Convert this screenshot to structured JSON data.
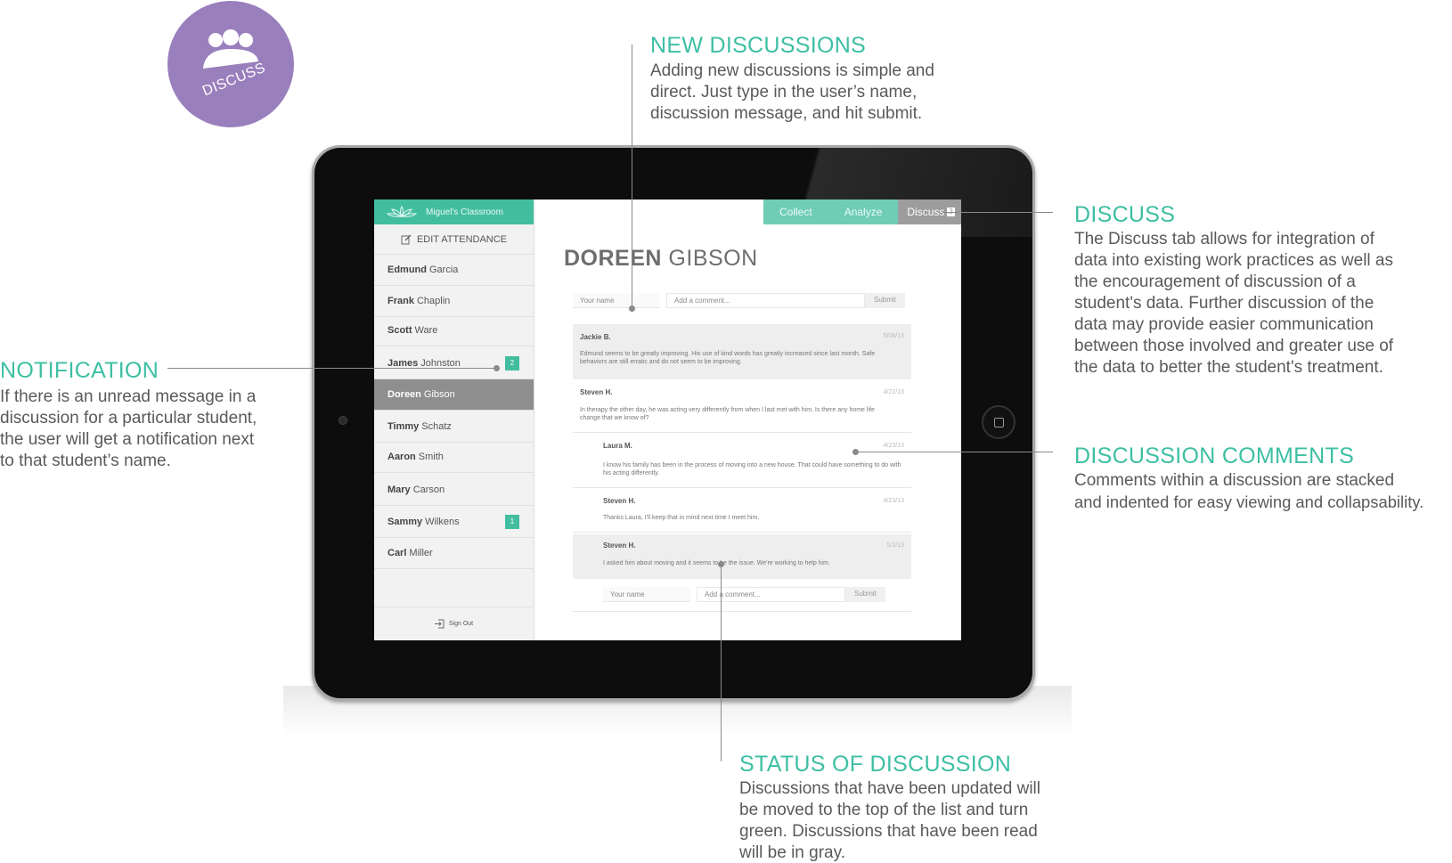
{
  "badge": {
    "label": "DISCUSS"
  },
  "annotations": {
    "new_discussions": {
      "title": "NEW DISCUSSIONS",
      "lines": [
        "Adding new discussions is simple and",
        "direct. Just type in the user’s name,",
        "discussion message, and hit submit."
      ]
    },
    "discuss": {
      "title": "DISCUSS",
      "lines": [
        "The Discuss tab allows for integration of",
        "data into existing work practices as well as",
        "the encouragement of discussion of a",
        "student's data. Further discussion of the",
        "data may provide easier communication",
        "between those involved and greater use of",
        "the data to better the student's treatment."
      ]
    },
    "notification": {
      "title": "NOTIFICATION",
      "lines": [
        "If there is an unread message in a",
        "discussion for a particular student,",
        "the user will get a notification next",
        "to that student’s name."
      ]
    },
    "discussion_comments": {
      "title": "DISCUSSION COMMENTS",
      "lines": [
        "Comments within a discussion are stacked",
        "and indented for easy viewing and collapsability."
      ]
    },
    "status": {
      "title": "STATUS OF DISCUSSION",
      "lines": [
        "Discussions that have been updated will",
        "be moved to the top of the list and turn",
        "green. Discussions that have been read",
        "will be in gray."
      ]
    }
  },
  "app": {
    "classroom": "Miguel's Classroom",
    "edit_attendance": "EDIT ATTENDANCE",
    "sign_out": "Sign Out",
    "nav": {
      "collect": "Collect",
      "analyze": "Analyze",
      "discuss": "Discuss",
      "discuss_count": "3"
    },
    "students": [
      {
        "first": "Edmund",
        "last": "Garcia",
        "notif": ""
      },
      {
        "first": "Frank",
        "last": "Chaplin",
        "notif": ""
      },
      {
        "first": "Scott",
        "last": "Ware",
        "notif": ""
      },
      {
        "first": "James",
        "last": "Johnston",
        "notif": "2"
      },
      {
        "first": "Doreen",
        "last": "Gibson",
        "notif": ""
      },
      {
        "first": "Timmy",
        "last": "Schatz",
        "notif": ""
      },
      {
        "first": "Aaron",
        "last": "Smith",
        "notif": ""
      },
      {
        "first": "Mary",
        "last": "Carson",
        "notif": ""
      },
      {
        "first": "Sammy",
        "last": "Wilkens",
        "notif": "1"
      },
      {
        "first": "Carl",
        "last": "Miller",
        "notif": ""
      }
    ],
    "student_first": "DOREEN",
    "student_last": "GIBSON",
    "form": {
      "name_placeholder": "Your name",
      "comment_placeholder": "Add a comment...",
      "submit": "Submit"
    },
    "discussions": [
      {
        "who": "Jackie B.",
        "date": "5/06/13",
        "msg": "Edmund seems to be greatly improving. His use of kind words has greatly increased since last month. Safe behaviors are still erratic and do not seem to be improving."
      },
      {
        "who": "Steven H.",
        "date": "4/22/13",
        "msg": "In therapy the other day, he was acting very differently from when I last met with him. Is there any home life change that we know of?"
      },
      {
        "who": "Laura M.",
        "date": "4/23/13",
        "msg": "I know his family has been in the process of moving into a new house. That could have something to do with his acting differently."
      },
      {
        "who": "Steven H.",
        "date": "4/23/13",
        "msg": "Thanks Laura, I'll keep that in mind next time I meet him."
      },
      {
        "who": "Steven H.",
        "date": "5/2/13",
        "msg": "I asked him about moving and it seems to be the issue. We're working to help him."
      }
    ]
  }
}
